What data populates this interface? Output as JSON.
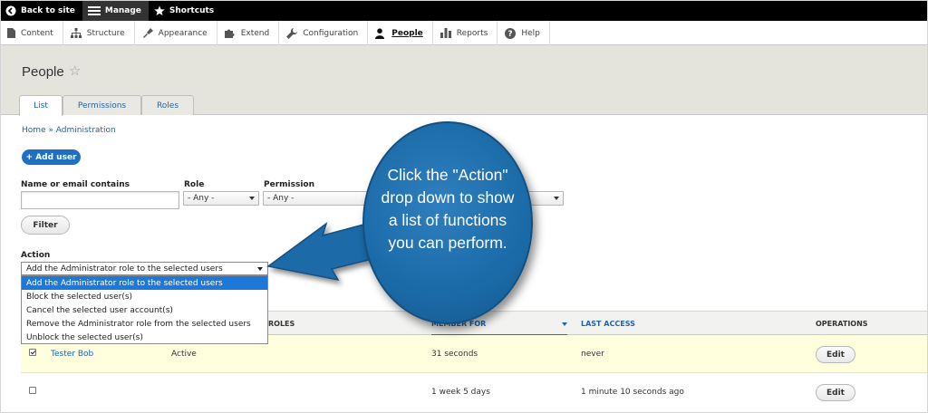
{
  "toolbar": {
    "back_label": "Back to site",
    "manage_label": "Manage",
    "shortcuts_label": "Shortcuts"
  },
  "tray": {
    "items": [
      {
        "label": "Content",
        "icon": "document-icon"
      },
      {
        "label": "Structure",
        "icon": "sitemap-icon"
      },
      {
        "label": "Appearance",
        "icon": "paintbrush-icon"
      },
      {
        "label": "Extend",
        "icon": "puzzle-icon"
      },
      {
        "label": "Configuration",
        "icon": "wrench-icon"
      },
      {
        "label": "People",
        "icon": "person-icon"
      },
      {
        "label": "Reports",
        "icon": "bar-chart-icon"
      },
      {
        "label": "Help",
        "icon": "help-icon"
      }
    ],
    "active": "People"
  },
  "page": {
    "title": "People",
    "tabs": [
      "List",
      "Permissions",
      "Roles"
    ],
    "active_tab": "List",
    "breadcrumb": "Home » Administration",
    "add_user_label": "+ Add user"
  },
  "filters": {
    "name_label": "Name or email contains",
    "name_value": "",
    "role_label": "Role",
    "role_value": "- Any -",
    "permission_label": "Permission",
    "permission_value": "- Any -",
    "filter_button": "Filter"
  },
  "action": {
    "label": "Action",
    "selected": "Add the Administrator role to the selected users",
    "options": [
      "Add the Administrator role to the selected users",
      "Block the selected user(s)",
      "Cancel the selected user account(s)",
      "Remove the Administrator role from the selected users",
      "Unblock the selected user(s)"
    ]
  },
  "table": {
    "headers": {
      "roles": "ROLES",
      "member_for": "MEMBER FOR",
      "last_access": "LAST ACCESS",
      "operations": "OPERATIONS"
    },
    "rows": [
      {
        "checked": true,
        "username": "Tester Bob",
        "status": "Active",
        "member_for": "31 seconds",
        "last_access": "never",
        "operation": "Edit"
      },
      {
        "checked": false,
        "username": "",
        "status": "",
        "member_for": "1 week 5 days",
        "last_access": "1 minute 10 seconds ago",
        "operation": "Edit"
      }
    ]
  },
  "callout": {
    "text_lines": [
      "Click the \"Action\"",
      "drop down to show",
      "a list of functions",
      "you can perform."
    ]
  },
  "colors": {
    "accent": "#1f6fc5",
    "selected_option": "#1e78d7",
    "header_bg": "#e4e3dc",
    "highlight_row": "#ffffdd",
    "callout": "#1b6aa8"
  }
}
